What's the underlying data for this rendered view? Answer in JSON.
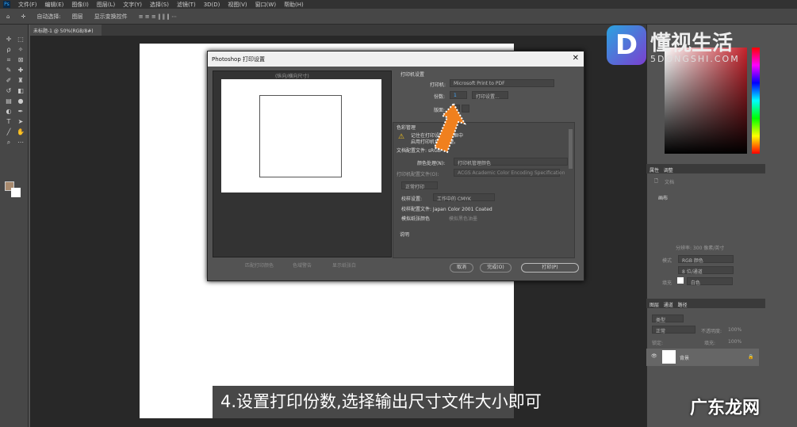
{
  "menu": [
    "文件(F)",
    "编辑(E)",
    "图像(I)",
    "图层(L)",
    "文字(Y)",
    "选择(S)",
    "滤镜(T)",
    "3D(D)",
    "视图(V)",
    "窗口(W)",
    "帮助(H)"
  ],
  "options": {
    "auto_select": "自动选择:",
    "layer": "图层",
    "show_transform": "显示变换控件"
  },
  "document_tab": "未标题-1 @ 50%(RGB/8#)",
  "dialog": {
    "title": "Photoshop 打印设置",
    "preview_label": "(纵向/横向尺寸)",
    "printer_section": "打印机设置",
    "printer_label": "打印机:",
    "printer_value": "Microsoft Print to PDF",
    "copies_label": "份数:",
    "copies_value": "1",
    "print_settings_button": "打印设置...",
    "layout_label": "版面:",
    "color_section": "色彩管理",
    "warning_text_1": "记住在打印设置对话框中",
    "warning_text_2": "启用打印机色彩管理。",
    "doc_profile": "文档配置文件: sRGB",
    "color_handling_label": "颜色处理(N):",
    "color_handling_value": "打印机管理颜色",
    "printer_profile_label": "打印机配置文件(O):",
    "printer_profile_value": "ACGS Academic Color Encoding Specification",
    "normal_print": "正常打印",
    "proof_setup_label": "校样设置:",
    "proof_setup_value": "工作中的 CMYK",
    "proof_profile": "校样配置文件: Japan Color 2001 Coated",
    "simulate_paper": "模拟纸张颜色",
    "simulate_black": "模拟黑色油墨",
    "description_section": "说明",
    "bottom_checks": [
      "匹配打印颜色",
      "色域警告",
      "显示纸张白"
    ],
    "cancel_button": "取消",
    "done_button": "完成(O)",
    "print_button": "打印(P)"
  },
  "panels": {
    "tabs_top": [
      "属性",
      "调整"
    ],
    "doc_label": "文档",
    "canvas_section": "画布",
    "resolution_text": "分辨率: 300 像素/英寸",
    "mode_label": "模式",
    "mode_value": "RGB 颜色",
    "bit_value": "8 位/通道",
    "fill_label": "填充",
    "fill_value": "白色",
    "layer_tabs": [
      "图层",
      "通道",
      "路径"
    ],
    "kind": "类型",
    "blend": "正常",
    "opacity_label": "不透明度:",
    "opacity_value": "100%",
    "lock_label": "锁定:",
    "fill_pct_label": "填充:",
    "fill_pct_value": "100%",
    "layer_name": "背景"
  },
  "colors": {
    "foreground": "#a88a6e",
    "background": "#ffffff",
    "picker_hue": "#c4222b",
    "arrow": "#f0801e"
  },
  "caption": "4.设置打印份数,选择输出尺寸文件大小即可",
  "brand": {
    "mark": "D",
    "name": "懂视生活",
    "domain": "5DONGSHI.COM"
  },
  "watermark": "广东龙网"
}
